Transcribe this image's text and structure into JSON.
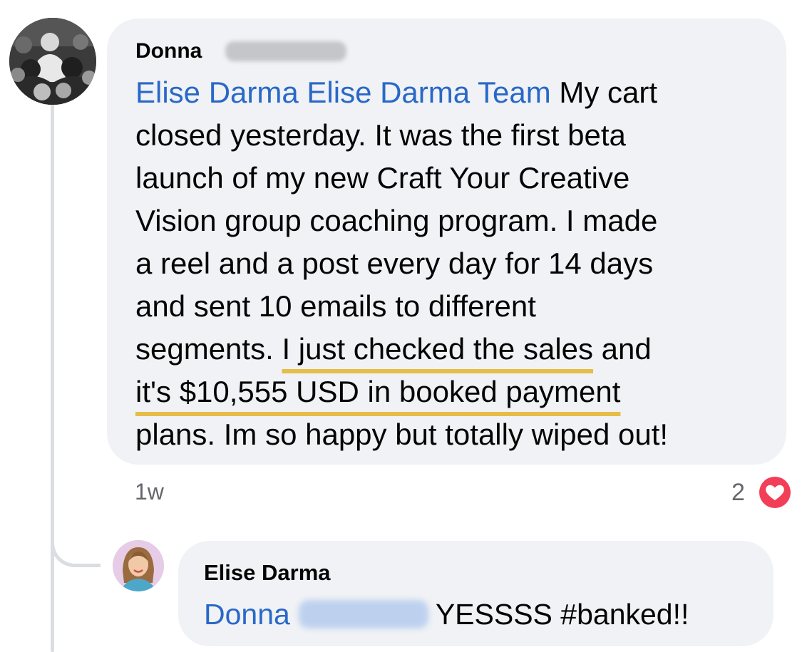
{
  "comment": {
    "author_first_name": "Donna",
    "text_lines": [
      {
        "mention": "Elise Darma Elise Darma Team",
        "rest": " My cart"
      },
      {
        "text": "closed yesterday. It was the first beta"
      },
      {
        "text": "launch of my new Craft Your Creative"
      },
      {
        "text": "Vision group coaching program. I made"
      },
      {
        "text": "a reel and a post every day for 14 days"
      },
      {
        "text": "and sent 10 emails to different"
      },
      {
        "pre": "segments. ",
        "underlined": "I just checked the sales",
        "post": " and"
      },
      {
        "underlined": "it's $10,555 USD in booked payment"
      },
      {
        "text": "plans. Im so happy but totally wiped out!"
      }
    ],
    "timestamp": "1w",
    "reaction_count": "2",
    "reaction_icon": "heart-icon"
  },
  "reply": {
    "author": "Elise Darma",
    "mention": "Donna",
    "text": "YESSSS #banked!!"
  },
  "colors": {
    "mention_blue": "#2968c8",
    "underline_gold": "#e6bd48",
    "bubble_bg": "#f0f2f5",
    "heart_red": "#f33e58",
    "meta_gray": "#65676b"
  }
}
